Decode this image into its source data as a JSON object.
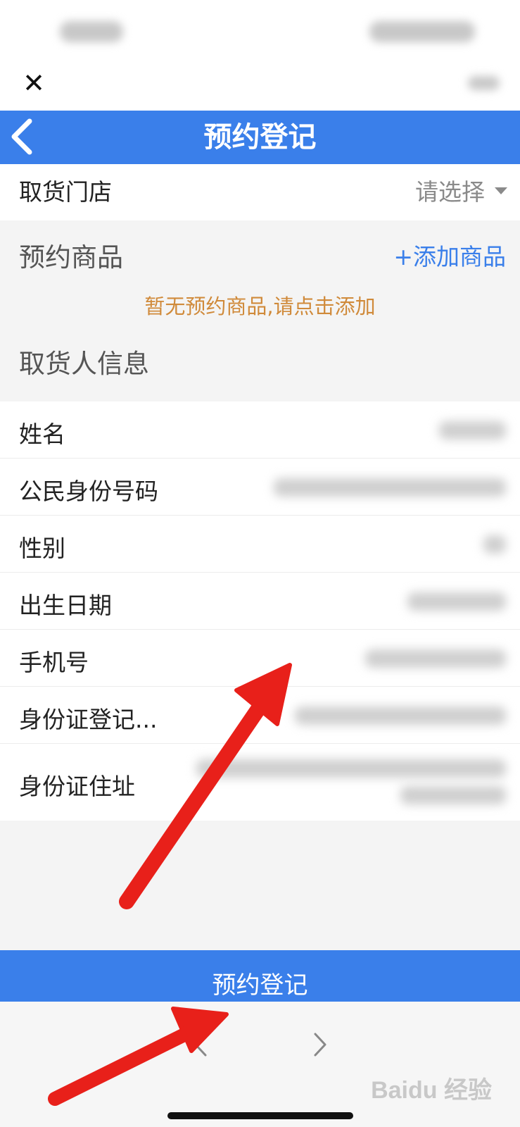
{
  "header": {
    "title": "预约登记"
  },
  "store": {
    "label": "取货门店",
    "value": "请选择"
  },
  "goods": {
    "title": "预约商品",
    "add_label": "+添加商品",
    "empty_tip": "暂无预约商品,请点击添加"
  },
  "pickup": {
    "title": "取货人信息",
    "fields": [
      {
        "label": "姓名"
      },
      {
        "label": "公民身份号码"
      },
      {
        "label": "性别"
      },
      {
        "label": "出生日期"
      },
      {
        "label": "手机号"
      },
      {
        "label": "身份证登记..."
      },
      {
        "label": "身份证住址"
      }
    ]
  },
  "submit": {
    "label": "预约登记"
  },
  "watermark": {
    "text": "Baidu 经验"
  },
  "colors": {
    "accent": "#3a7fea",
    "warning_text": "#d08a3a",
    "annotation_arrow": "#e8201a"
  }
}
